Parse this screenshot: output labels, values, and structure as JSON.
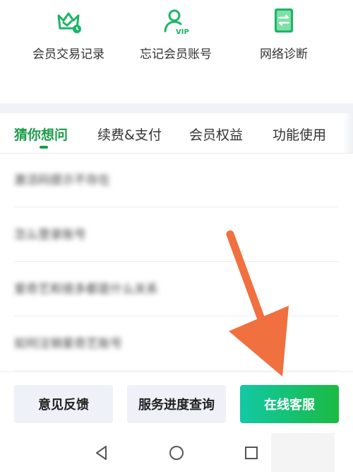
{
  "shortcuts": [
    {
      "label": "会员交易记录",
      "icon": "crown-clock-icon"
    },
    {
      "label": "忘记会员账号",
      "icon": "user-vip-icon"
    },
    {
      "label": "网络诊断",
      "icon": "network-transfer-icon"
    }
  ],
  "tabs": [
    {
      "label": "猜你想问",
      "active": true
    },
    {
      "label": "续费&支付",
      "active": false
    },
    {
      "label": "会员权益",
      "active": false
    },
    {
      "label": "功能使用",
      "active": false
    }
  ],
  "faq": [
    {
      "text": "激活码提示不存在"
    },
    {
      "text": "怎么登录账号"
    },
    {
      "text": "爱奇艺和很多都是什么关系"
    },
    {
      "text": "如何注销爱奇艺账号"
    }
  ],
  "bottom_buttons": {
    "feedback": "意见反馈",
    "progress": "服务进度查询",
    "support": "在线客服"
  },
  "navbar": {
    "back": "back-triangle-icon",
    "home": "home-circle-icon",
    "recent": "recent-square-icon"
  },
  "colors": {
    "accent": "#1c9c4a",
    "annotation_arrow": "#f07040",
    "button_gradient_start": "#13c8a6",
    "button_gradient_end": "#1cba43"
  }
}
